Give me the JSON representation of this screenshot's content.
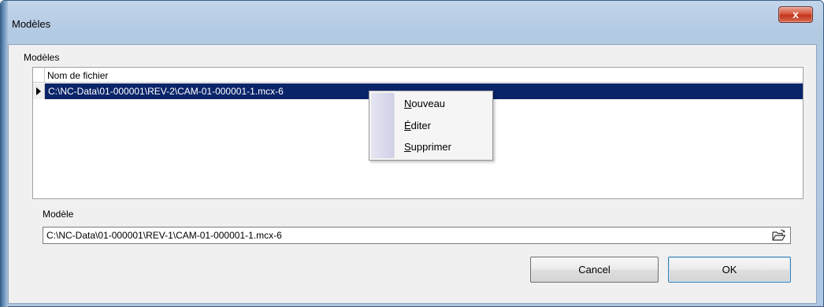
{
  "window": {
    "title": "Modèles",
    "close_label": "x"
  },
  "models_group": {
    "label": "Modèles",
    "grid": {
      "columns": [
        "Nom de fichier"
      ],
      "rows": [
        {
          "filename": "C:\\NC-Data\\01-000001\\REV-2\\CAM-01-000001-1.mcx-6",
          "selected": true
        }
      ]
    }
  },
  "context_menu": {
    "items": [
      {
        "accel": "N",
        "rest": "ouveau"
      },
      {
        "accel": "É",
        "rest": "diter"
      },
      {
        "accel": "S",
        "rest": "upprimer"
      }
    ]
  },
  "model_field": {
    "label": "Modèle",
    "value": "C:\\NC-Data\\01-000001\\REV-1\\CAM-01-000001-1.mcx-6",
    "browse_icon": "open-folder-icon"
  },
  "buttons": {
    "cancel": "Cancel",
    "ok": "OK"
  },
  "colors": {
    "selection": "#0a246a",
    "close_button": "#c8452a"
  }
}
